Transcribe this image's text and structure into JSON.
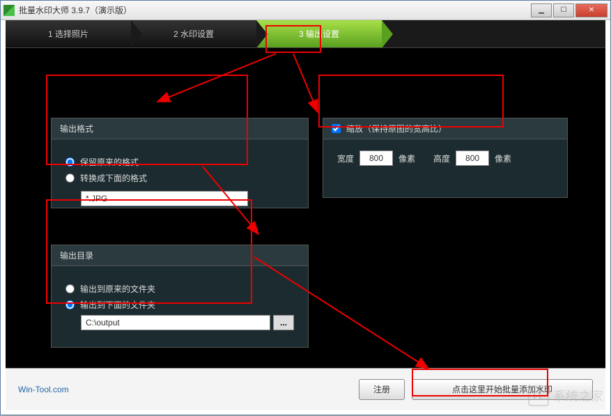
{
  "window": {
    "title": "批量水印大师 3.9.7（演示版）"
  },
  "steps": {
    "s1": "1 选择照片",
    "s2": "2 水印设置",
    "s3": "3 输出设置"
  },
  "format_panel": {
    "title": "输出格式",
    "opt_keep": "保留原来的格式",
    "opt_convert": "转换成下面的格式",
    "value": "*.JPG"
  },
  "scale_panel": {
    "title": "缩放（保持原图的宽高比）",
    "checked": true,
    "width_label": "宽度",
    "width_value": "800",
    "height_label": "高度",
    "height_value": "800",
    "unit": "像素"
  },
  "outdir_panel": {
    "title": "输出目录",
    "opt_same": "输出到原来的文件夹",
    "opt_other": "输出到下面的文件夹",
    "path": "C:\\output",
    "browse": "..."
  },
  "footer": {
    "link": "Win-Tool.com",
    "register": "注册",
    "start": "点击这里开始批量添加水印"
  },
  "watermark": {
    "text": "系统之家"
  }
}
